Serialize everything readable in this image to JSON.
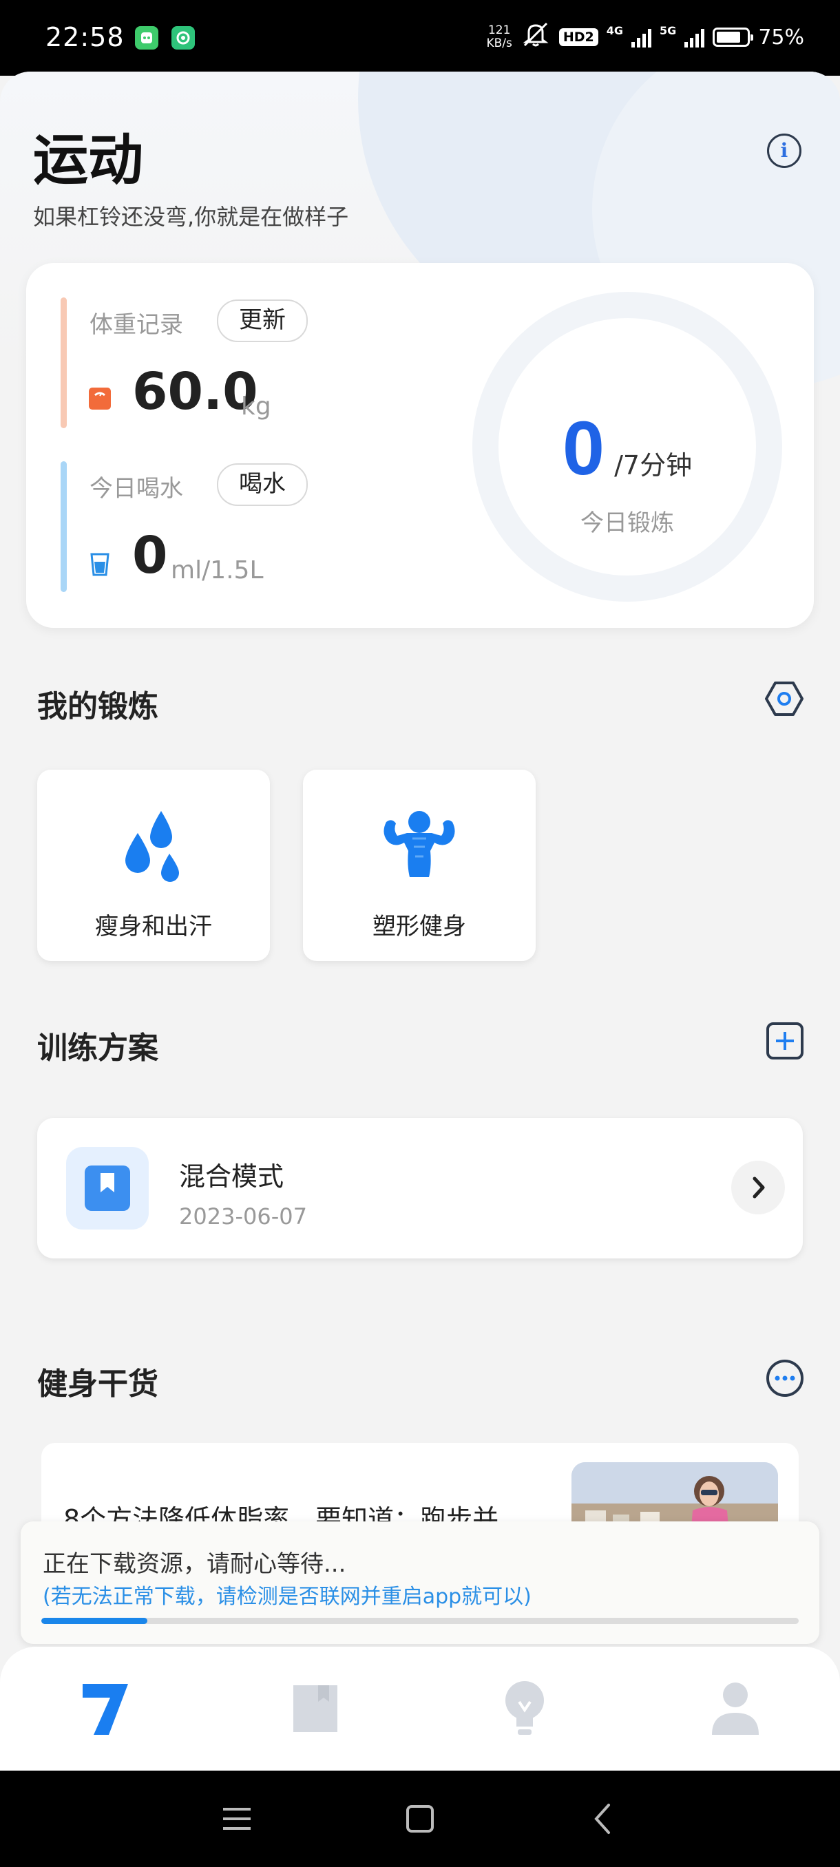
{
  "status_bar": {
    "time": "22:58",
    "net_speed_value": "121",
    "net_speed_unit": "KB/s",
    "hd_badge": "HD2",
    "net1": "4G",
    "net2": "5G",
    "battery": "75%",
    "icons": [
      "app-icon-green",
      "app-icon-refresh",
      "mute-bell-icon",
      "signal-icon",
      "battery-icon"
    ]
  },
  "header": {
    "title": "运动",
    "subtitle": "如果杠铃还没弯,你就是在做样子",
    "info_icon": "info-icon"
  },
  "summary": {
    "weight": {
      "label": "体重记录",
      "button": "更新",
      "value": "60.0",
      "unit": "kg",
      "accent": "#f8c9b4",
      "icon": "scale-icon"
    },
    "water": {
      "label": "今日喝水",
      "button": "喝水",
      "value": "0",
      "unit": "ml/1.5L",
      "accent": "#a9d6f7",
      "icon": "water-cup-icon"
    },
    "exercise": {
      "value": "0",
      "unit": "/7分钟",
      "caption": "今日锻炼",
      "progress": 0
    }
  },
  "my_exercise": {
    "title": "我的锻炼",
    "settings_icon": "settings-icon",
    "items": [
      {
        "label": "瘦身和出汗",
        "icon": "sweat-drops-icon"
      },
      {
        "label": "塑形健身",
        "icon": "muscle-man-icon"
      }
    ]
  },
  "plans": {
    "title": "训练方案",
    "add_icon": "add-icon",
    "items": [
      {
        "name": "混合模式",
        "date": "2023-06-07",
        "icon": "bookmark-icon"
      }
    ]
  },
  "tips": {
    "title": "健身干货",
    "more_icon": "more-icon",
    "article_title": "8个方法降低体脂率，要知道：跑步并"
  },
  "download_toast": {
    "message": "正在下载资源，请耐心等待...",
    "hint": "(若无法正常下载，请检测是否联网并重启app就可以)",
    "progress": 0.14
  },
  "tabbar": {
    "tabs": [
      "seven-logo-icon",
      "book-icon",
      "bulb-icon",
      "person-icon"
    ],
    "active_color": "#1a7ef0",
    "inactive_color": "#d5d9e0"
  },
  "colors": {
    "accent_blue": "#1f63e6",
    "text": "#222222"
  }
}
